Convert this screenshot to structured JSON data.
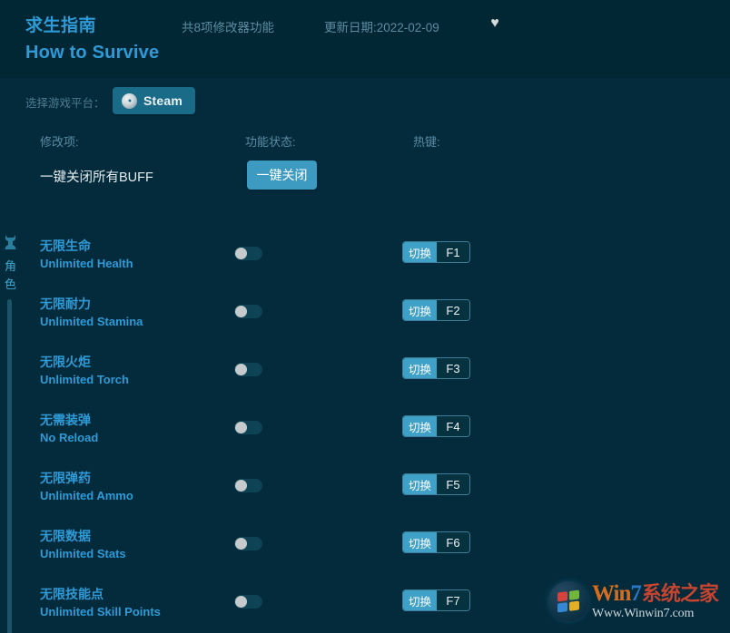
{
  "header": {
    "title_cn": "求生指南",
    "title_en": "How to Survive",
    "feature_count": "共8项修改器功能",
    "update_date": "更新日期:2022-02-09",
    "favorite_icon": "heart-icon",
    "favorite_glyph": "♥"
  },
  "platform": {
    "label": "选择游戏平台：",
    "selected": "Steam",
    "icon": "steam-icon"
  },
  "columns": {
    "item": "修改项:",
    "status": "功能状态:",
    "hotkey": "热键:"
  },
  "master": {
    "label": "一键关闭所有BUFF",
    "button": "一键关闭"
  },
  "sidebar": {
    "icon": "character-icon",
    "category": "角色"
  },
  "rows": [
    {
      "cn": "无限生命",
      "en": "Unlimited Health",
      "toggle": "off",
      "action": "切换",
      "key": "F1"
    },
    {
      "cn": "无限耐力",
      "en": "Unlimited Stamina",
      "toggle": "off",
      "action": "切换",
      "key": "F2"
    },
    {
      "cn": "无限火炬",
      "en": "Unlimited Torch",
      "toggle": "off",
      "action": "切换",
      "key": "F3"
    },
    {
      "cn": "无需装弹",
      "en": "No Reload",
      "toggle": "off",
      "action": "切换",
      "key": "F4"
    },
    {
      "cn": "无限弹药",
      "en": "Unlimited Ammo",
      "toggle": "off",
      "action": "切换",
      "key": "F5"
    },
    {
      "cn": "无限数据",
      "en": "Unlimited Stats",
      "toggle": "off",
      "action": "切换",
      "key": "F6"
    },
    {
      "cn": "无限技能点",
      "en": "Unlimited Skill Points",
      "toggle": "off",
      "action": "切换",
      "key": "F7"
    }
  ],
  "watermark": {
    "brand_win": "Win",
    "brand_seven": "7",
    "brand_cn": "系统之家",
    "url": "Www.Winwin7.com"
  },
  "colors": {
    "background": "#032b3c",
    "header_bg": "#022734",
    "accent_blue": "#2f9ad6",
    "accent_teal": "#3fa0c8",
    "muted_text": "#5b8ba2",
    "white_text": "#e6edf1"
  }
}
